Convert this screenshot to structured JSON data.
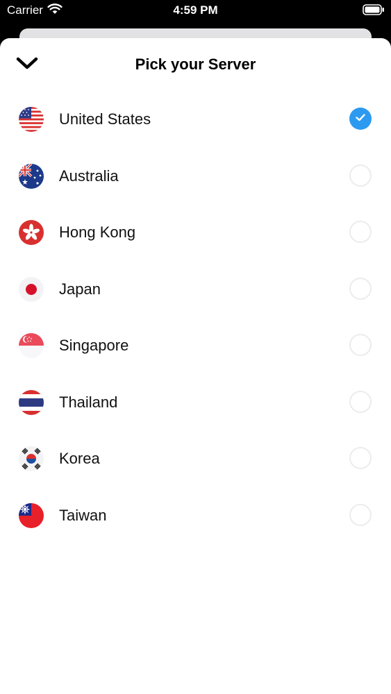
{
  "status_bar": {
    "carrier": "Carrier",
    "time": "4:59 PM"
  },
  "header": {
    "title": "Pick your Server",
    "close_icon": "chevron-down-icon"
  },
  "accent_color": "#2c9af0",
  "servers": [
    {
      "name": "United States",
      "flag": "us-flag-icon",
      "selected": true
    },
    {
      "name": "Australia",
      "flag": "au-flag-icon",
      "selected": false
    },
    {
      "name": "Hong Kong",
      "flag": "hk-flag-icon",
      "selected": false
    },
    {
      "name": "Japan",
      "flag": "jp-flag-icon",
      "selected": false
    },
    {
      "name": "Singapore",
      "flag": "sg-flag-icon",
      "selected": false
    },
    {
      "name": "Thailand",
      "flag": "th-flag-icon",
      "selected": false
    },
    {
      "name": "Korea",
      "flag": "kr-flag-icon",
      "selected": false
    },
    {
      "name": "Taiwan",
      "flag": "tw-flag-icon",
      "selected": false
    }
  ]
}
